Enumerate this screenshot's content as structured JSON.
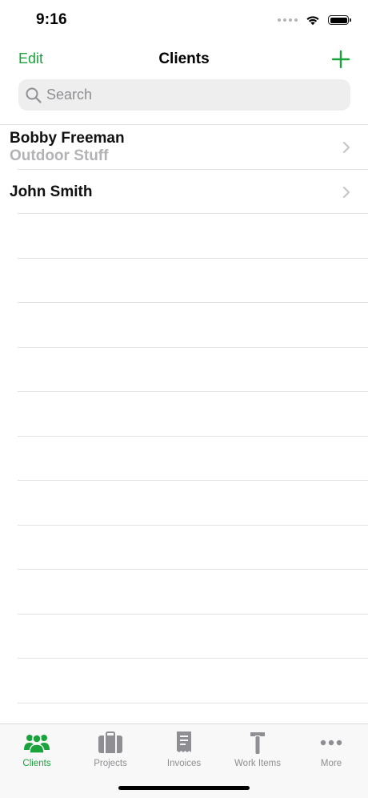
{
  "status_bar": {
    "time": "9:16"
  },
  "nav": {
    "edit_label": "Edit",
    "title": "Clients",
    "add_icon": "plus-icon"
  },
  "search": {
    "placeholder": "Search",
    "value": ""
  },
  "clients": [
    {
      "name": "Bobby Freeman",
      "company": "Outdoor Stuff"
    },
    {
      "name": "John Smith",
      "company": ""
    }
  ],
  "tabs": [
    {
      "label": "Clients",
      "icon": "people-icon",
      "active": true
    },
    {
      "label": "Projects",
      "icon": "briefcase-icon",
      "active": false
    },
    {
      "label": "Invoices",
      "icon": "receipt-icon",
      "active": false
    },
    {
      "label": "Work Items",
      "icon": "hammer-icon",
      "active": false
    },
    {
      "label": "More",
      "icon": "more-icon",
      "active": false
    }
  ],
  "colors": {
    "accent": "#1aa33b",
    "inactive_tab": "#8e8e93",
    "secondary_text": "#b3b3b6",
    "separator": "#e3e3e6",
    "search_background": "#eeeeef"
  }
}
